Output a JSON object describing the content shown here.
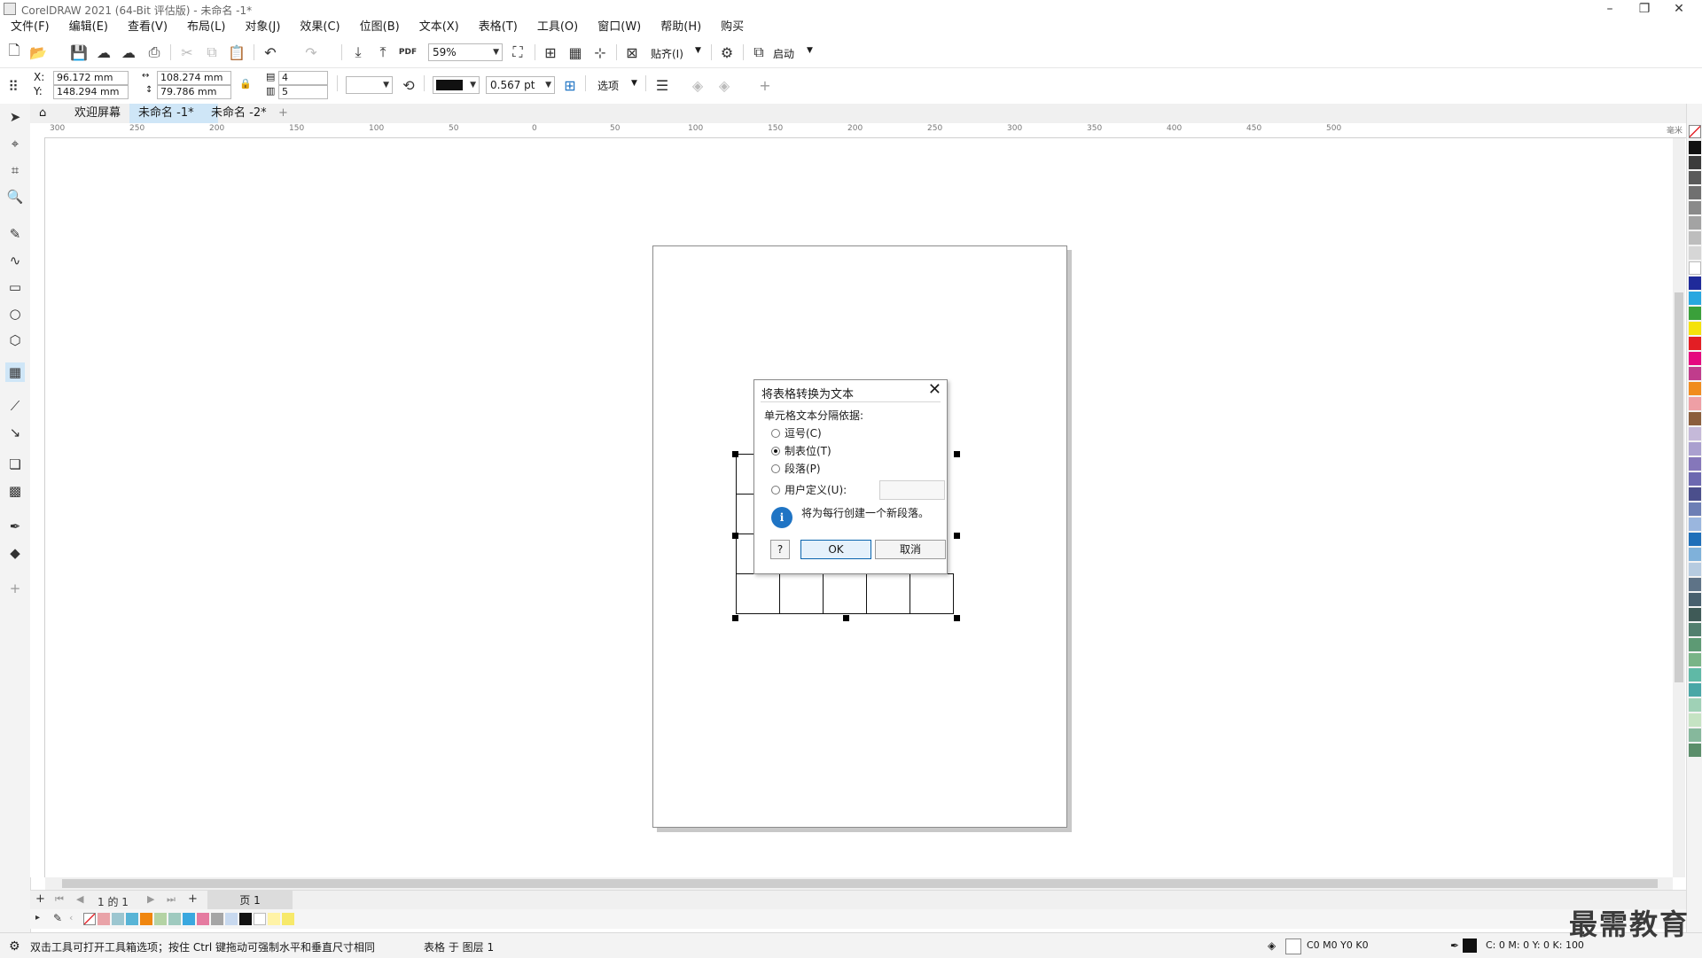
{
  "window": {
    "title": "CorelDRAW 2021 (64-Bit 评估版) - 未命名 -1*",
    "min_icon": "minimize-icon",
    "restore_icon": "restore-icon",
    "close_icon": "close-icon"
  },
  "menu": [
    "文件(F)",
    "编辑(E)",
    "查看(V)",
    "布局(L)",
    "对象(J)",
    "效果(C)",
    "位图(B)",
    "文本(X)",
    "表格(T)",
    "工具(O)",
    "窗口(W)",
    "帮助(H)",
    "购买"
  ],
  "std_toolbar": {
    "zoom": "59%",
    "snap_label": "贴齐(I)",
    "launch_label": "启动"
  },
  "property_bar": {
    "x_label": "X:",
    "y_label": "Y:",
    "x_value": "96.172 mm",
    "y_value": "148.294 mm",
    "width_value": "108.274 mm",
    "height_value": "79.786 mm",
    "rows": "4",
    "cols": "5",
    "outline_width": "0.567 pt",
    "options_label": "选项"
  },
  "doc_tabs": {
    "welcome": "欢迎屏幕",
    "doc1": "未命名 -1*",
    "doc2": "未命名 -2*",
    "add": "+"
  },
  "ruler_h": [
    "300",
    "250",
    "200",
    "150",
    "100",
    "50",
    "0",
    "50",
    "100",
    "150",
    "200",
    "250",
    "300",
    "350",
    "400",
    "450",
    "500"
  ],
  "ruler_unit": "毫米",
  "dialog": {
    "title": "将表格转换为文本",
    "group_label": "单元格文本分隔依据:",
    "options": [
      "逗号(C)",
      "制表位(T)",
      "段落(P)",
      "用户定义(U):"
    ],
    "selected_index": 1,
    "info_text": "将为每行创建一个新段落。",
    "help_label": "?",
    "ok_label": "OK",
    "cancel_label": "取消"
  },
  "page_nav": {
    "page_of": "1 的 1",
    "page_tab": "页 1"
  },
  "colors": {
    "doc_palette": [
      "#e9a3a8",
      "#9cc6d0",
      "#58b4d6",
      "#f0860f",
      "#b4d3a4",
      "#9fcabf",
      "#3aa8df",
      "#e57ba0",
      "#a5a5a5",
      "#c8d9ef",
      "#111111",
      "#ffffff",
      "#fff3a6",
      "#f7e96a"
    ],
    "right_palette": [
      "#111111",
      "#3c3c3c",
      "#5a5a5a",
      "#707070",
      "#8a8a8a",
      "#a3a3a3",
      "#bdbdbd",
      "#d6d6d6",
      "#ffffff",
      "#1f2a9a",
      "#28a7e0",
      "#3aa03a",
      "#f5e20a",
      "#e31e24",
      "#e5077f",
      "#c03c8c",
      "#f08c1e",
      "#ee9fa5",
      "#8b5e3c",
      "#c5b9d9",
      "#aaa0cf",
      "#8577ba",
      "#6d69b0",
      "#4b4f8c",
      "#6d7fb5",
      "#9ab6de",
      "#1f6fb9",
      "#7fb1da",
      "#b6cbe0",
      "#5e7387",
      "#49606e",
      "#3f5a57",
      "#527f6e",
      "#5d9a74",
      "#79b487",
      "#5fb9a6",
      "#49a7a6",
      "#9fd1b6",
      "#c5e3c3",
      "#86b89c",
      "#5b8e6b"
    ],
    "accent": "#0a64ad"
  },
  "status": {
    "hint": "双击工具可打开工具箱选项；按住 Ctrl 键拖动可强制水平和垂直尺寸相同",
    "layer": "表格 于 图层 1",
    "fill_value": "C0 M0 Y0 K0",
    "outline_value": "C: 0 M: 0 Y: 0 K: 100"
  },
  "watermark": "最需教育"
}
